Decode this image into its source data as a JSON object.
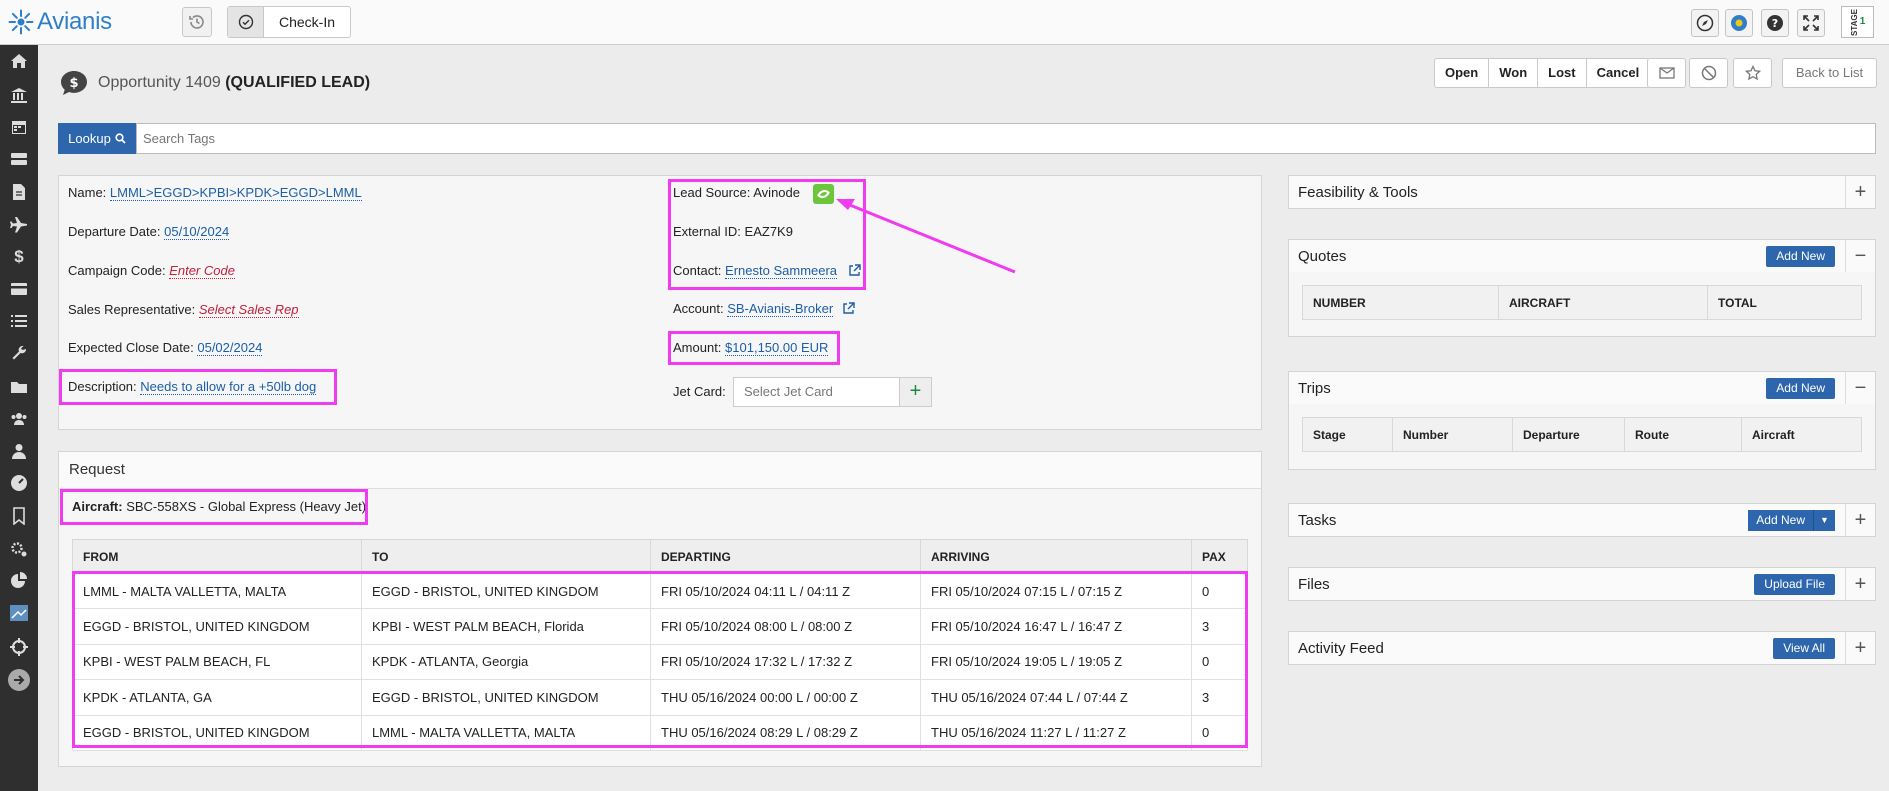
{
  "app": {
    "name": "Avianis",
    "checkin_label": "Check-In",
    "stage_text": "STAGE",
    "stage_value": "1"
  },
  "page": {
    "title_prefix": "Opportunity 1409",
    "title_status": "(QUALIFIED LEAD)"
  },
  "status_buttons": [
    "Open",
    "Won",
    "Lost",
    "Cancel"
  ],
  "back_label": "Back to List",
  "lookup": {
    "label": "Lookup",
    "placeholder": "Search Tags"
  },
  "details": {
    "name_label": "Name:",
    "name_value": "LMML>EGGD>KPBI>KPDK>EGGD>LMML",
    "departure_label": "Departure Date:",
    "departure_value": "05/10/2024",
    "campaign_label": "Campaign Code:",
    "campaign_value": "Enter Code",
    "sales_label": "Sales Representative:",
    "sales_value": "Select Sales Rep",
    "close_label": "Expected Close Date:",
    "close_value": "05/02/2024",
    "desc_label": "Description:",
    "desc_value": "Needs to allow for a +50lb dog",
    "lead_label": "Lead Source:",
    "lead_value": "Avinode",
    "ext_label": "External ID:",
    "ext_value": "EAZ7K9",
    "contact_label": "Contact:",
    "contact_value": "Ernesto Sammeera",
    "account_label": "Account:",
    "account_value": "SB-Avianis-Broker",
    "amount_label": "Amount:",
    "amount_value": "$101,150.00 EUR",
    "jet_label": "Jet Card:",
    "jet_placeholder": "Select Jet Card"
  },
  "request": {
    "title": "Request",
    "aircraft_label": "Aircraft:",
    "aircraft_value": "SBC-558XS - Global Express (Heavy Jet)",
    "columns": [
      "FROM",
      "TO",
      "DEPARTING",
      "ARRIVING",
      "PAX"
    ],
    "rows": [
      [
        "LMML - MALTA VALLETTA, MALTA",
        "EGGD - BRISTOL, UNITED KINGDOM",
        "FRI 05/10/2024 04:11 L / 04:11 Z",
        "FRI 05/10/2024 07:15 L / 07:15 Z",
        "0"
      ],
      [
        "EGGD - BRISTOL, UNITED KINGDOM",
        "KPBI - WEST PALM BEACH, Florida",
        "FRI 05/10/2024 08:00 L / 08:00 Z",
        "FRI 05/10/2024 16:47 L / 16:47 Z",
        "3"
      ],
      [
        "KPBI - WEST PALM BEACH, FL",
        "KPDK - ATLANTA, Georgia",
        "FRI 05/10/2024 17:32 L / 17:32 Z",
        "FRI 05/10/2024 19:05 L / 19:05 Z",
        "0"
      ],
      [
        "KPDK - ATLANTA, GA",
        "EGGD - BRISTOL, UNITED KINGDOM",
        "THU 05/16/2024 00:00 L / 00:00 Z",
        "THU 05/16/2024 07:44 L / 07:44 Z",
        "3"
      ],
      [
        "EGGD - BRISTOL, UNITED KINGDOM",
        "LMML - MALTA VALLETTA, MALTA",
        "THU 05/16/2024 08:29 L / 08:29 Z",
        "THU 05/16/2024 11:27 L / 11:27 Z",
        "0"
      ]
    ]
  },
  "right": {
    "feasibility": {
      "title": "Feasibility & Tools",
      "toggle": "+"
    },
    "quotes": {
      "title": "Quotes",
      "button": "Add New",
      "toggle": "−",
      "columns": [
        "NUMBER",
        "AIRCRAFT",
        "TOTAL"
      ]
    },
    "trips": {
      "title": "Trips",
      "button": "Add New",
      "toggle": "−",
      "columns": [
        "Stage",
        "Number",
        "Departure",
        "Route",
        "Aircraft"
      ]
    },
    "tasks": {
      "title": "Tasks",
      "button": "Add New",
      "toggle": "+"
    },
    "files": {
      "title": "Files",
      "button": "Upload File",
      "toggle": "+"
    },
    "activity": {
      "title": "Activity Feed",
      "button": "View All",
      "toggle": "+"
    }
  },
  "colors": {
    "accent": "#2d66ad",
    "highlight": "#f03cf0",
    "lead_badge": "#6cc63c",
    "sidebar": "#2f2f2f"
  },
  "sidebar_icons": [
    "home-icon",
    "bank-icon",
    "calendar-icon",
    "server-icon",
    "document-icon",
    "airplane-icon",
    "dollar-icon",
    "credit-card-icon",
    "list-icon",
    "wrench-icon",
    "folder-icon",
    "users-icon",
    "user-icon",
    "dashboard-icon",
    "bookmark-icon",
    "settings-icon",
    "pie-chart-icon",
    "monitor-icon",
    "crosshair-icon",
    "arrow-right-icon"
  ]
}
